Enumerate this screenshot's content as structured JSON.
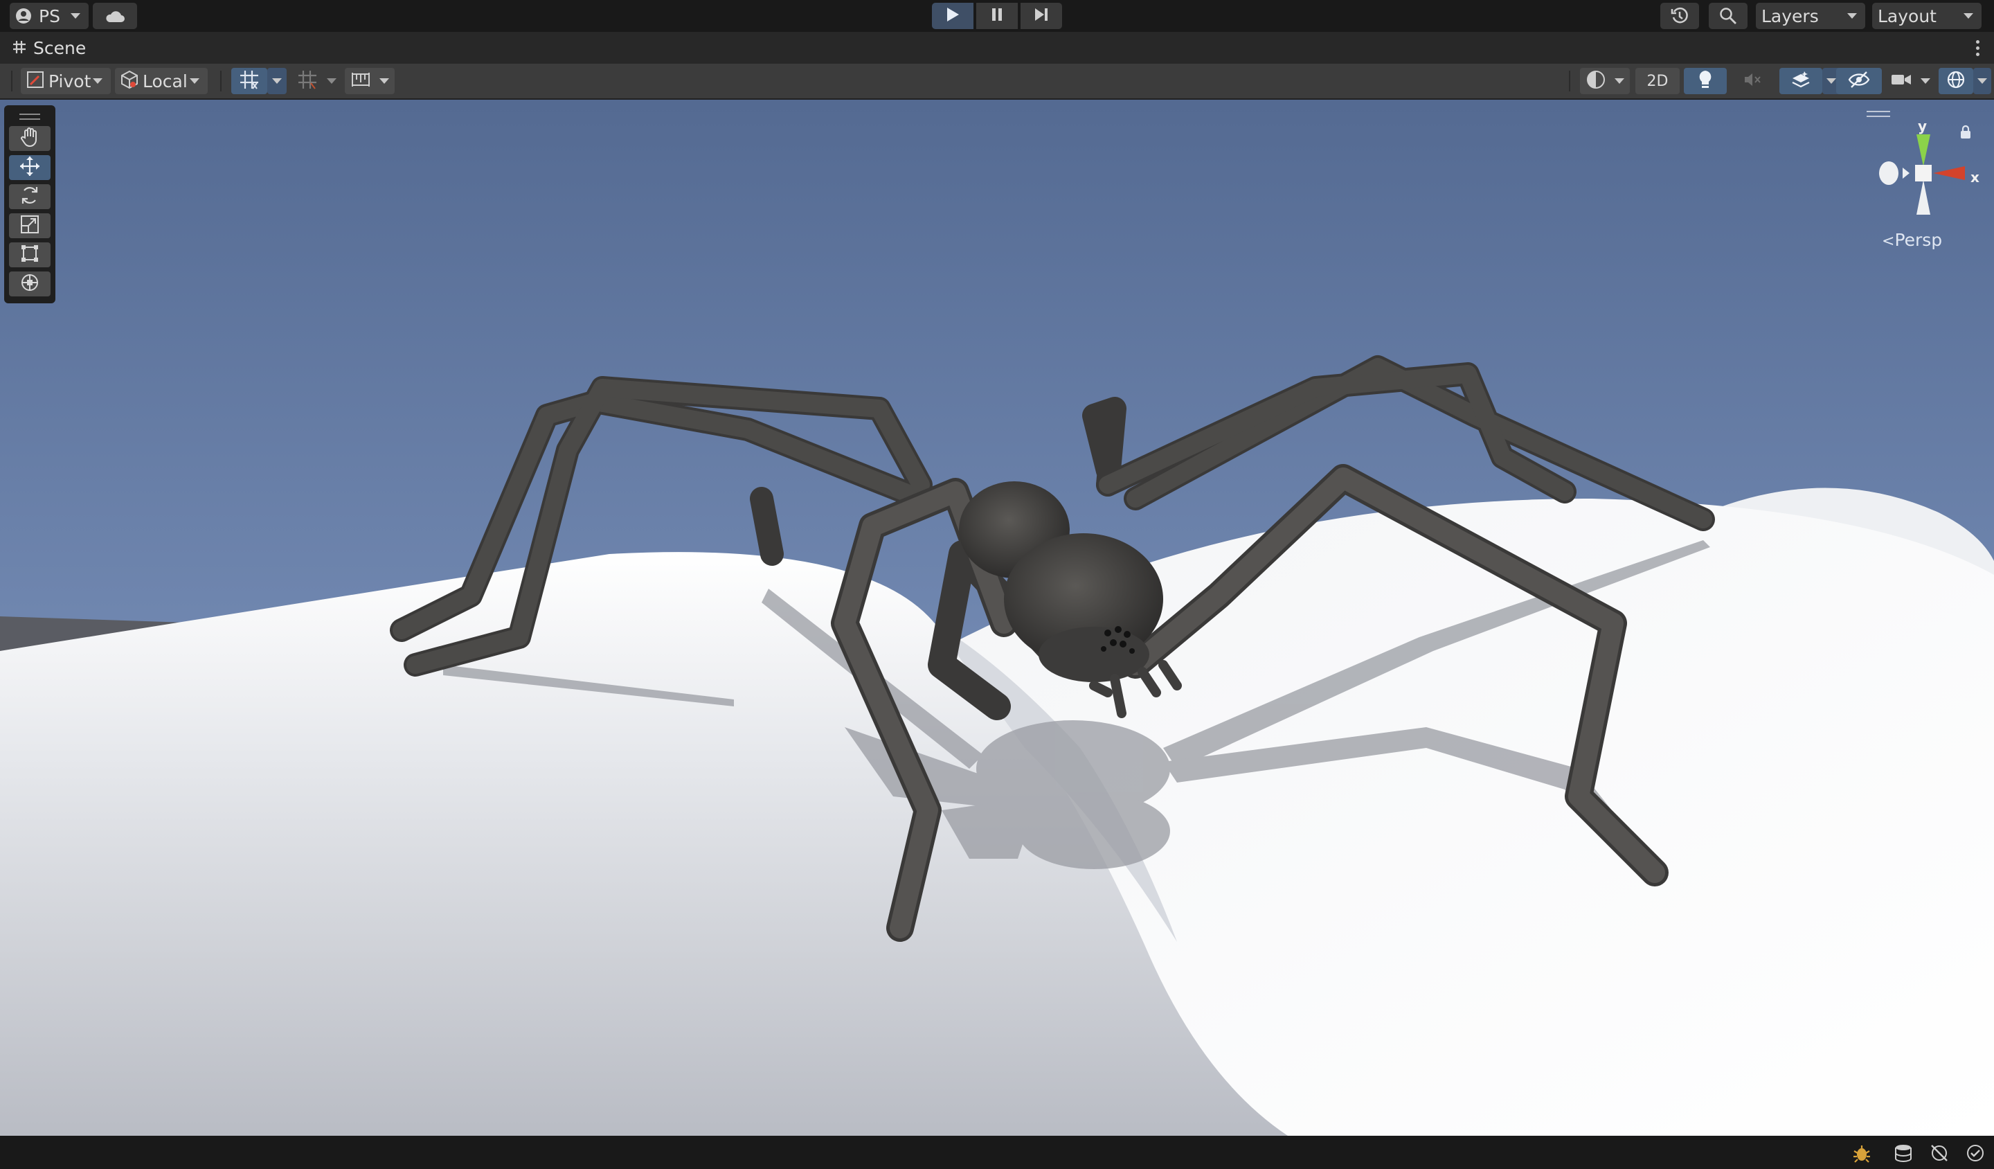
{
  "topbar": {
    "account_label": "PS",
    "account_icon": "user-circle-icon",
    "cloud_icon": "cloud-icon",
    "play_icon": "play-icon",
    "pause_icon": "pause-icon",
    "step_icon": "step-icon",
    "history_icon": "history-icon",
    "search_icon": "search-icon",
    "layers_label": "Layers",
    "layout_label": "Layout"
  },
  "tab": {
    "icon": "scene-hash-icon",
    "label": "Scene"
  },
  "toolbar": {
    "pivot_label": "Pivot",
    "local_label": "Local",
    "mode_2d_label": "2D"
  },
  "gizmo": {
    "y_label": "y",
    "x_label": "x",
    "projection_label": "Persp"
  },
  "colors": {
    "accent": "#46607e",
    "sky_top": "#546a92",
    "sky_bottom": "#a9bed8",
    "ground": "#f2f3f5",
    "spider": "#3f3e3d"
  }
}
